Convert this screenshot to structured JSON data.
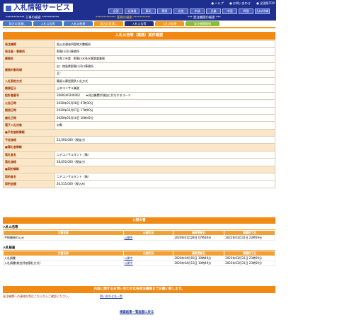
{
  "header": {
    "logo_text": "入札情報サービス",
    "toplinks": [
      "● ヘルプ",
      "● お問い合わせ",
      "● 全国版TOP"
    ],
    "regions": [
      "全国",
      "北海道",
      "東北",
      "関東",
      "北陸",
      "中部",
      "近畿",
      "中国",
      "四国",
      "九州/沖縄"
    ],
    "section_a": "************ 工事の検索 ***********",
    "section_b": "************* 業務の検索 ***********",
    "section_c": "*** 発注機関の検索 ***"
  },
  "tabs": [
    {
      "label": "発注の見通し"
    },
    {
      "label": "入札公告等"
    },
    {
      "label": "入札の結果"
    },
    {
      "label": "発注の見通し"
    },
    {
      "label": "入札公告等"
    },
    {
      "label": "入札の結果"
    },
    {
      "label": "発注機関情報"
    }
  ],
  "detail": {
    "title": "入札公告等（業務）案件概要",
    "rows": [
      {
        "k": "発注機関",
        "v": "国土交通省四国地方整備局"
      },
      {
        "k": "発注者・事務所",
        "v": "那賀川河川事務所"
      },
      {
        "k": "業務名",
        "v": "令和２年度　那賀川水系水質調査業務"
      },
      {
        "k": "業務対象地域",
        "v": "自：徳島県那賀川河川事務所"
      },
      {
        "k": "",
        "v": "至："
      },
      {
        "k": "入札契約方式",
        "v": "簡易公募型競争入札方式"
      },
      {
        "k": "業務区分",
        "v": "土木コンサル業務"
      },
      {
        "k": "設計書番号",
        "v": "2080340200002　　★発注機関が独自に付与するコード"
      },
      {
        "k": "公告日時",
        "v": "2020年01月28日 07時30分"
      },
      {
        "k": "期限日時",
        "v": "2020年02月07日 17時00分"
      },
      {
        "k": "開札日時",
        "v": "2020年03月10日 10時42分"
      },
      {
        "k": "電子入札対象",
        "v": "対象"
      }
    ],
    "sections": {
      "yotei": "■予定価格情報",
      "rakusatsu": "■落札者情報",
      "keiyaku": "■契約情報"
    },
    "yotei_row": {
      "k": "予定価格",
      "v": "22,090,000（税抜き）"
    },
    "rakusatsu_rows": [
      {
        "k": "落札者名",
        "v": "ニチコンサルタント（株）"
      },
      {
        "k": "落札価格",
        "v": "18,650,000（税抜き）"
      }
    ],
    "keiyaku_rows": [
      {
        "k": "契約者名",
        "v": "ニチコンサルタント（株）"
      },
      {
        "k": "契約金額",
        "v": "20,515,000（税込み）"
      }
    ]
  },
  "public_docs": {
    "title": "公開文書",
    "group1_title": "入札公告等",
    "group2_title": "入札経過",
    "columns": [
      "文書名称",
      "公開状況",
      "最終更新日",
      "掲載終了日"
    ],
    "group1_rows": [
      {
        "name": "手続開始の公示",
        "dl": "公開中",
        "updated": "2020年01月28日 07時30分",
        "end": "2022年03月31日 23時59分"
      }
    ],
    "group2_rows": [
      {
        "name": "入札調書",
        "dl": "公開中",
        "updated": "2020年04月03日 10時49分",
        "end": "2022年03月31日 23時59分"
      },
      {
        "name": "入札調書(総合評価落札方式)",
        "dl": "公開中",
        "updated": "2020年04月13日 10時49分",
        "end": "2022年03月31日 23時59分"
      }
    ]
  },
  "footer": {
    "notice": "内容に関するお問い合わせは各発注機関までお願い致します。",
    "contact_text": "発注機関への連絡先等はこちらからご確認ください。",
    "contact_link": "問い合わせ先一覧",
    "back_link": "検索結果一覧画面に戻る"
  }
}
